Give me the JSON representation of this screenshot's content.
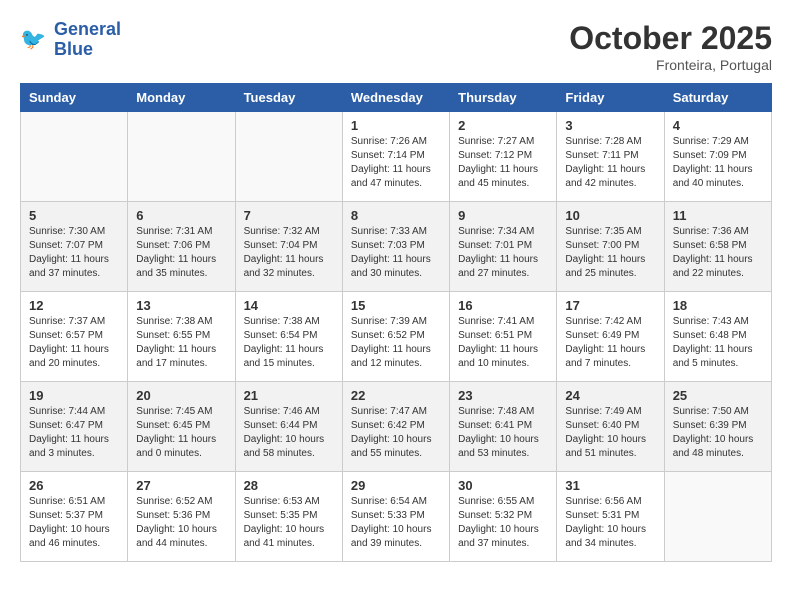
{
  "header": {
    "logo_line1": "General",
    "logo_line2": "Blue",
    "month": "October 2025",
    "location": "Fronteira, Portugal"
  },
  "days_of_week": [
    "Sunday",
    "Monday",
    "Tuesday",
    "Wednesday",
    "Thursday",
    "Friday",
    "Saturday"
  ],
  "weeks": [
    [
      {
        "day": "",
        "info": ""
      },
      {
        "day": "",
        "info": ""
      },
      {
        "day": "",
        "info": ""
      },
      {
        "day": "1",
        "info": "Sunrise: 7:26 AM\nSunset: 7:14 PM\nDaylight: 11 hours\nand 47 minutes."
      },
      {
        "day": "2",
        "info": "Sunrise: 7:27 AM\nSunset: 7:12 PM\nDaylight: 11 hours\nand 45 minutes."
      },
      {
        "day": "3",
        "info": "Sunrise: 7:28 AM\nSunset: 7:11 PM\nDaylight: 11 hours\nand 42 minutes."
      },
      {
        "day": "4",
        "info": "Sunrise: 7:29 AM\nSunset: 7:09 PM\nDaylight: 11 hours\nand 40 minutes."
      }
    ],
    [
      {
        "day": "5",
        "info": "Sunrise: 7:30 AM\nSunset: 7:07 PM\nDaylight: 11 hours\nand 37 minutes."
      },
      {
        "day": "6",
        "info": "Sunrise: 7:31 AM\nSunset: 7:06 PM\nDaylight: 11 hours\nand 35 minutes."
      },
      {
        "day": "7",
        "info": "Sunrise: 7:32 AM\nSunset: 7:04 PM\nDaylight: 11 hours\nand 32 minutes."
      },
      {
        "day": "8",
        "info": "Sunrise: 7:33 AM\nSunset: 7:03 PM\nDaylight: 11 hours\nand 30 minutes."
      },
      {
        "day": "9",
        "info": "Sunrise: 7:34 AM\nSunset: 7:01 PM\nDaylight: 11 hours\nand 27 minutes."
      },
      {
        "day": "10",
        "info": "Sunrise: 7:35 AM\nSunset: 7:00 PM\nDaylight: 11 hours\nand 25 minutes."
      },
      {
        "day": "11",
        "info": "Sunrise: 7:36 AM\nSunset: 6:58 PM\nDaylight: 11 hours\nand 22 minutes."
      }
    ],
    [
      {
        "day": "12",
        "info": "Sunrise: 7:37 AM\nSunset: 6:57 PM\nDaylight: 11 hours\nand 20 minutes."
      },
      {
        "day": "13",
        "info": "Sunrise: 7:38 AM\nSunset: 6:55 PM\nDaylight: 11 hours\nand 17 minutes."
      },
      {
        "day": "14",
        "info": "Sunrise: 7:38 AM\nSunset: 6:54 PM\nDaylight: 11 hours\nand 15 minutes."
      },
      {
        "day": "15",
        "info": "Sunrise: 7:39 AM\nSunset: 6:52 PM\nDaylight: 11 hours\nand 12 minutes."
      },
      {
        "day": "16",
        "info": "Sunrise: 7:41 AM\nSunset: 6:51 PM\nDaylight: 11 hours\nand 10 minutes."
      },
      {
        "day": "17",
        "info": "Sunrise: 7:42 AM\nSunset: 6:49 PM\nDaylight: 11 hours\nand 7 minutes."
      },
      {
        "day": "18",
        "info": "Sunrise: 7:43 AM\nSunset: 6:48 PM\nDaylight: 11 hours\nand 5 minutes."
      }
    ],
    [
      {
        "day": "19",
        "info": "Sunrise: 7:44 AM\nSunset: 6:47 PM\nDaylight: 11 hours\nand 3 minutes."
      },
      {
        "day": "20",
        "info": "Sunrise: 7:45 AM\nSunset: 6:45 PM\nDaylight: 11 hours\nand 0 minutes."
      },
      {
        "day": "21",
        "info": "Sunrise: 7:46 AM\nSunset: 6:44 PM\nDaylight: 10 hours\nand 58 minutes."
      },
      {
        "day": "22",
        "info": "Sunrise: 7:47 AM\nSunset: 6:42 PM\nDaylight: 10 hours\nand 55 minutes."
      },
      {
        "day": "23",
        "info": "Sunrise: 7:48 AM\nSunset: 6:41 PM\nDaylight: 10 hours\nand 53 minutes."
      },
      {
        "day": "24",
        "info": "Sunrise: 7:49 AM\nSunset: 6:40 PM\nDaylight: 10 hours\nand 51 minutes."
      },
      {
        "day": "25",
        "info": "Sunrise: 7:50 AM\nSunset: 6:39 PM\nDaylight: 10 hours\nand 48 minutes."
      }
    ],
    [
      {
        "day": "26",
        "info": "Sunrise: 6:51 AM\nSunset: 5:37 PM\nDaylight: 10 hours\nand 46 minutes."
      },
      {
        "day": "27",
        "info": "Sunrise: 6:52 AM\nSunset: 5:36 PM\nDaylight: 10 hours\nand 44 minutes."
      },
      {
        "day": "28",
        "info": "Sunrise: 6:53 AM\nSunset: 5:35 PM\nDaylight: 10 hours\nand 41 minutes."
      },
      {
        "day": "29",
        "info": "Sunrise: 6:54 AM\nSunset: 5:33 PM\nDaylight: 10 hours\nand 39 minutes."
      },
      {
        "day": "30",
        "info": "Sunrise: 6:55 AM\nSunset: 5:32 PM\nDaylight: 10 hours\nand 37 minutes."
      },
      {
        "day": "31",
        "info": "Sunrise: 6:56 AM\nSunset: 5:31 PM\nDaylight: 10 hours\nand 34 minutes."
      },
      {
        "day": "",
        "info": ""
      }
    ]
  ]
}
